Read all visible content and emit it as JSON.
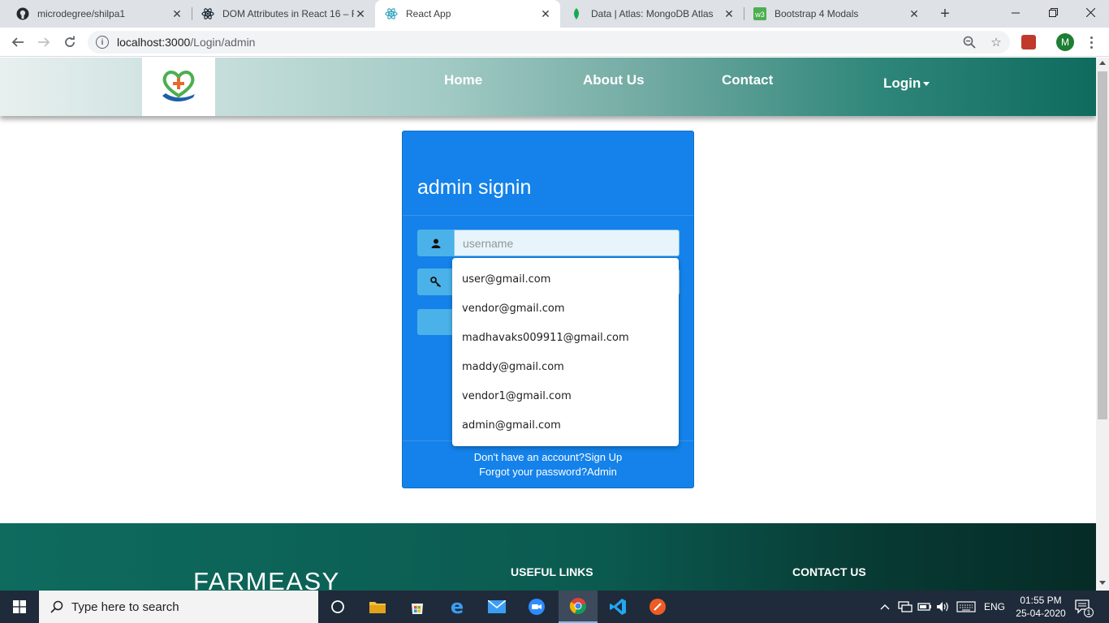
{
  "browser": {
    "tabs": [
      {
        "title": "microdegree/shilpa1",
        "icon": "github-icon"
      },
      {
        "title": "DOM Attributes in React 16 – R",
        "icon": "react-icon"
      },
      {
        "title": "React App",
        "icon": "react-icon",
        "active": true
      },
      {
        "title": "Data | Atlas: MongoDB Atlas",
        "icon": "mongodb-leaf-icon"
      },
      {
        "title": "Bootstrap 4 Modals",
        "icon": "w3schools-icon"
      }
    ],
    "url_host": "localhost:3000",
    "url_path": "/Login/admin",
    "profile_initial": "M"
  },
  "site": {
    "nav": {
      "home": "Home",
      "about": "About Us",
      "contact": "Contact",
      "login": "Login"
    },
    "card": {
      "title": "admin signin",
      "username_placeholder": "username",
      "footer_line1": "Don't have an account?Sign Up",
      "footer_line2": "Forgot your password?Admin"
    },
    "autocomplete": [
      "user@gmail.com",
      "vendor@gmail.com",
      "madhavaks009911@gmail.com",
      "maddy@gmail.com",
      "vendor1@gmail.com",
      "admin@gmail.com"
    ],
    "footer": {
      "brand": "FARMEASY",
      "useful_links": "USEFUL LINKS",
      "contact_us": "CONTACT US"
    },
    "colors": {
      "card": "#1482ea",
      "addon": "#4ab2e8",
      "nav_gradient_end": "#0e6b5e"
    }
  },
  "taskbar": {
    "search_placeholder": "Type here to search",
    "language": "ENG",
    "time": "01:55 PM",
    "date": "25-04-2020",
    "notification_count": "1"
  }
}
